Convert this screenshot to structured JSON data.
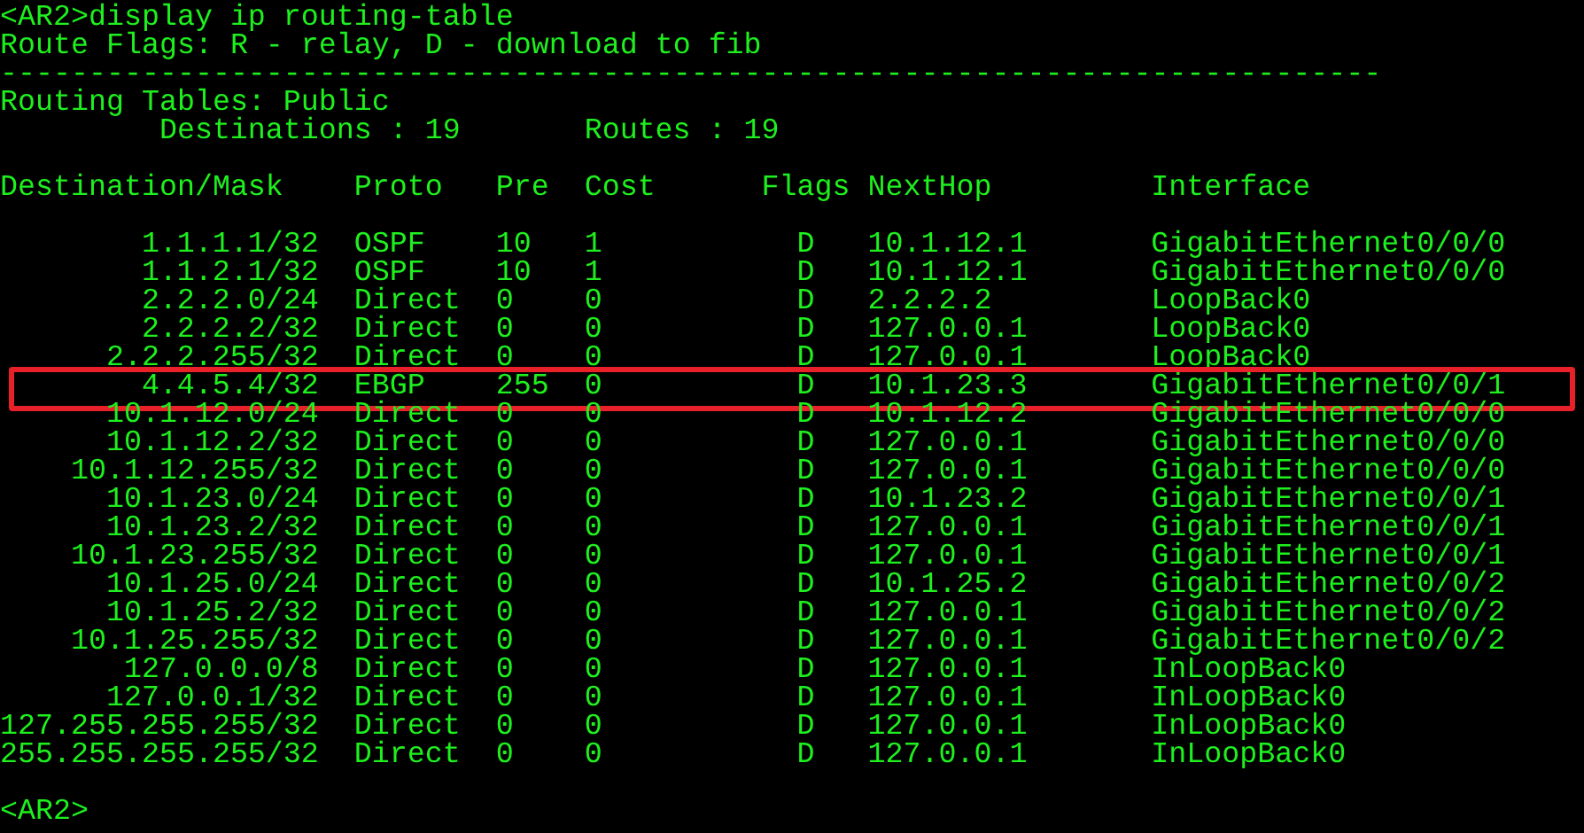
{
  "command": "<AR2>display ip routing-table",
  "flags_legend": "Route Flags: R - relay, D - download to fib",
  "separator": "------------------------------------------------------------------------------",
  "table_name": "Routing Tables: Public",
  "summary": {
    "destinations": "Destinations : 19",
    "routes": "Routes : 19"
  },
  "columns": [
    "Destination/Mask",
    "Proto",
    "Pre",
    "Cost",
    "Flags",
    "NextHop",
    "Interface"
  ],
  "rows": [
    {
      "destination": "1.1.1.1/32",
      "proto": "OSPF",
      "pre": "10",
      "cost": "1",
      "flags": "D",
      "nexthop": "10.1.12.1",
      "interface": "GigabitEthernet0/0/0",
      "highlighted": false
    },
    {
      "destination": "1.1.2.1/32",
      "proto": "OSPF",
      "pre": "10",
      "cost": "1",
      "flags": "D",
      "nexthop": "10.1.12.1",
      "interface": "GigabitEthernet0/0/0",
      "highlighted": false
    },
    {
      "destination": "2.2.2.0/24",
      "proto": "Direct",
      "pre": "0",
      "cost": "0",
      "flags": "D",
      "nexthop": "2.2.2.2",
      "interface": "LoopBack0",
      "highlighted": false
    },
    {
      "destination": "2.2.2.2/32",
      "proto": "Direct",
      "pre": "0",
      "cost": "0",
      "flags": "D",
      "nexthop": "127.0.0.1",
      "interface": "LoopBack0",
      "highlighted": false
    },
    {
      "destination": "2.2.2.255/32",
      "proto": "Direct",
      "pre": "0",
      "cost": "0",
      "flags": "D",
      "nexthop": "127.0.0.1",
      "interface": "LoopBack0",
      "highlighted": false
    },
    {
      "destination": "4.4.5.4/32",
      "proto": "EBGP",
      "pre": "255",
      "cost": "0",
      "flags": "D",
      "nexthop": "10.1.23.3",
      "interface": "GigabitEthernet0/0/1",
      "highlighted": true
    },
    {
      "destination": "10.1.12.0/24",
      "proto": "Direct",
      "pre": "0",
      "cost": "0",
      "flags": "D",
      "nexthop": "10.1.12.2",
      "interface": "GigabitEthernet0/0/0",
      "highlighted": false
    },
    {
      "destination": "10.1.12.2/32",
      "proto": "Direct",
      "pre": "0",
      "cost": "0",
      "flags": "D",
      "nexthop": "127.0.0.1",
      "interface": "GigabitEthernet0/0/0",
      "highlighted": false
    },
    {
      "destination": "10.1.12.255/32",
      "proto": "Direct",
      "pre": "0",
      "cost": "0",
      "flags": "D",
      "nexthop": "127.0.0.1",
      "interface": "GigabitEthernet0/0/0",
      "highlighted": false
    },
    {
      "destination": "10.1.23.0/24",
      "proto": "Direct",
      "pre": "0",
      "cost": "0",
      "flags": "D",
      "nexthop": "10.1.23.2",
      "interface": "GigabitEthernet0/0/1",
      "highlighted": false
    },
    {
      "destination": "10.1.23.2/32",
      "proto": "Direct",
      "pre": "0",
      "cost": "0",
      "flags": "D",
      "nexthop": "127.0.0.1",
      "interface": "GigabitEthernet0/0/1",
      "highlighted": false
    },
    {
      "destination": "10.1.23.255/32",
      "proto": "Direct",
      "pre": "0",
      "cost": "0",
      "flags": "D",
      "nexthop": "127.0.0.1",
      "interface": "GigabitEthernet0/0/1",
      "highlighted": false
    },
    {
      "destination": "10.1.25.0/24",
      "proto": "Direct",
      "pre": "0",
      "cost": "0",
      "flags": "D",
      "nexthop": "10.1.25.2",
      "interface": "GigabitEthernet0/0/2",
      "highlighted": false
    },
    {
      "destination": "10.1.25.2/32",
      "proto": "Direct",
      "pre": "0",
      "cost": "0",
      "flags": "D",
      "nexthop": "127.0.0.1",
      "interface": "GigabitEthernet0/0/2",
      "highlighted": false
    },
    {
      "destination": "10.1.25.255/32",
      "proto": "Direct",
      "pre": "0",
      "cost": "0",
      "flags": "D",
      "nexthop": "127.0.0.1",
      "interface": "GigabitEthernet0/0/2",
      "highlighted": false
    },
    {
      "destination": "127.0.0.0/8",
      "proto": "Direct",
      "pre": "0",
      "cost": "0",
      "flags": "D",
      "nexthop": "127.0.0.1",
      "interface": "InLoopBack0",
      "highlighted": false
    },
    {
      "destination": "127.0.0.1/32",
      "proto": "Direct",
      "pre": "0",
      "cost": "0",
      "flags": "D",
      "nexthop": "127.0.0.1",
      "interface": "InLoopBack0",
      "highlighted": false
    },
    {
      "destination": "127.255.255.255/32",
      "proto": "Direct",
      "pre": "0",
      "cost": "0",
      "flags": "D",
      "nexthop": "127.0.0.1",
      "interface": "InLoopBack0",
      "highlighted": false
    },
    {
      "destination": "255.255.255.255/32",
      "proto": "Direct",
      "pre": "0",
      "cost": "0",
      "flags": "D",
      "nexthop": "127.0.0.1",
      "interface": "InLoopBack0",
      "highlighted": false
    }
  ],
  "prompt": "<AR2>"
}
